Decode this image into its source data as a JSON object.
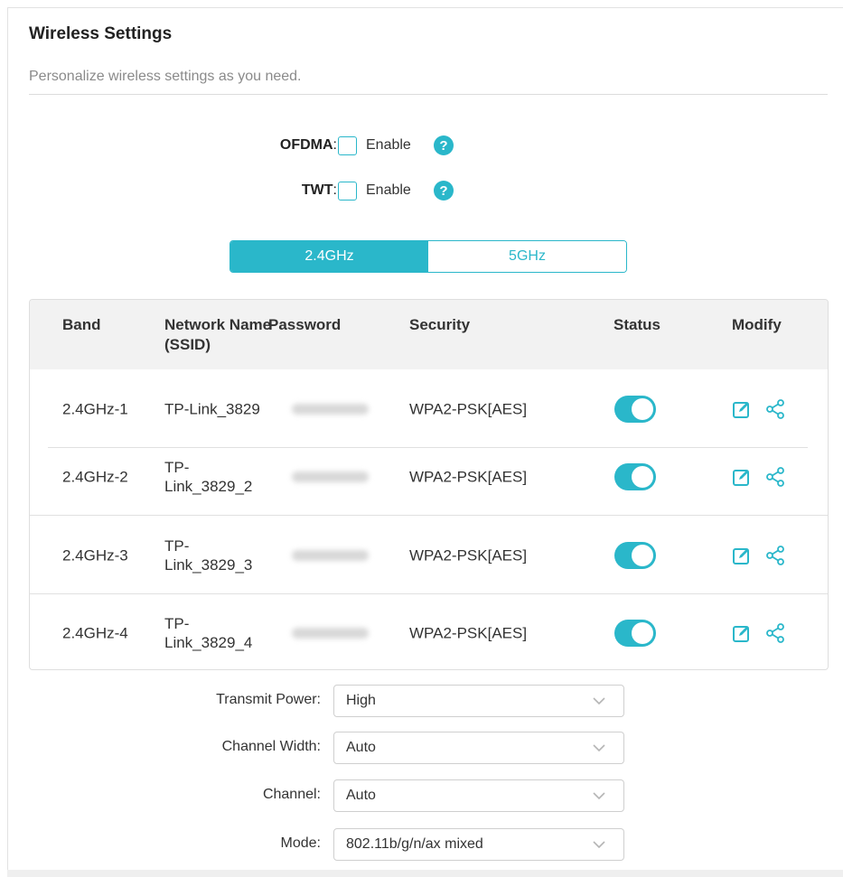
{
  "header": {
    "title": "Wireless Settings",
    "subtitle": "Personalize wireless settings as you need."
  },
  "options": [
    {
      "label": "OFDMA",
      "colon": ":",
      "checkbox_label": "Enable",
      "checked": false
    },
    {
      "label": "TWT",
      "colon": ":",
      "checkbox_label": "Enable",
      "checked": false
    }
  ],
  "help_glyph": "?",
  "bands": {
    "tabs": [
      "2.4GHz",
      "5GHz"
    ],
    "active": "2.4GHz"
  },
  "table": {
    "headers": {
      "band": "Band",
      "ssid_line1": "Network Name",
      "ssid_line2": "(SSID)",
      "password": "Password",
      "security": "Security",
      "status": "Status",
      "modify": "Modify"
    },
    "rows": [
      {
        "band": "2.4GHz-1",
        "ssid_line1": "TP-Link_3829",
        "ssid_line2": "",
        "security": "WPA2-PSK[AES]",
        "status_on": true
      },
      {
        "band": "2.4GHz-2",
        "ssid_line1": "TP-",
        "ssid_line2": "Link_3829_2",
        "security": "WPA2-PSK[AES]",
        "status_on": true
      },
      {
        "band": "2.4GHz-3",
        "ssid_line1": "TP-",
        "ssid_line2": "Link_3829_3",
        "security": "WPA2-PSK[AES]",
        "status_on": true
      },
      {
        "band": "2.4GHz-4",
        "ssid_line1": "TP-",
        "ssid_line2": "Link_3829_4",
        "security": "WPA2-PSK[AES]",
        "status_on": true
      }
    ]
  },
  "settings": {
    "transmit_power": {
      "label": "Transmit Power:",
      "value": "High"
    },
    "channel_width": {
      "label": "Channel Width:",
      "value": "Auto"
    },
    "channel": {
      "label": "Channel:",
      "value": "Auto"
    },
    "mode": {
      "label": "Mode:",
      "value": "802.11b/g/n/ax mixed"
    }
  },
  "colors": {
    "accent": "#2ab7ca",
    "header_bg": "#f2f2f2",
    "text": "#333333",
    "muted": "#8a8a8a"
  },
  "icons": [
    "help-icon",
    "edit-icon",
    "share-icon",
    "chevron-down-icon"
  ]
}
